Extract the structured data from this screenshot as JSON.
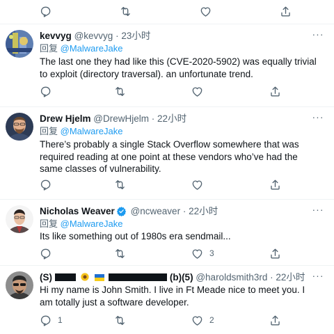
{
  "top_actions": {
    "reply_count": "",
    "retweet_count": "",
    "like_count": ""
  },
  "tweets": [
    {
      "name": "kevvyg",
      "handle": "@kevvyg",
      "dot": "·",
      "time": "23小时",
      "reply_prefix": "回复",
      "reply_to": "@MalwareJake",
      "text": "The last one they had like this (CVE-2020-5902) was equally trivial to exploit (directory traversal). an unfortunate trend.",
      "reply_count": "",
      "retweet_count": "",
      "like_count": ""
    },
    {
      "name": "Drew Hjelm",
      "handle": "@DrewHjelm",
      "dot": "·",
      "time": "22小时",
      "reply_prefix": "回复",
      "reply_to": "@MalwareJake",
      "text": "There’s probably a single Stack Overflow somewhere that was required reading at one point at these vendors who’ve had the same classes of vulnerability.",
      "reply_count": "",
      "retweet_count": "",
      "like_count": ""
    },
    {
      "name": "Nicholas Weaver",
      "handle": "@ncweaver",
      "dot": "·",
      "time": "22小时",
      "reply_prefix": "回复",
      "reply_to": "@MalwareJake",
      "text": "Its like something out of 1980s era sendmail...",
      "reply_count": "",
      "retweet_count": "",
      "like_count": "3"
    },
    {
      "name_start": "(S)",
      "name_end": "(b)(5)",
      "handle": "@haroldsmith3rd",
      "dot": "·",
      "time": "22小时",
      "text": "Hi my name is John Smith. I live in Ft Meade nice to meet you. I am totally just a software developer.",
      "reply_count": "1",
      "retweet_count": "",
      "like_count": "2"
    }
  ],
  "icons": {
    "reply": "reply-icon",
    "retweet": "retweet-icon",
    "like": "heart-icon",
    "share": "share-icon",
    "more": "more-icon",
    "verified": "verified-badge-icon"
  },
  "colors": {
    "text": "#0f1419",
    "secondary": "#536471",
    "accent": "#1d9bf0",
    "divider": "#eff3f4"
  }
}
